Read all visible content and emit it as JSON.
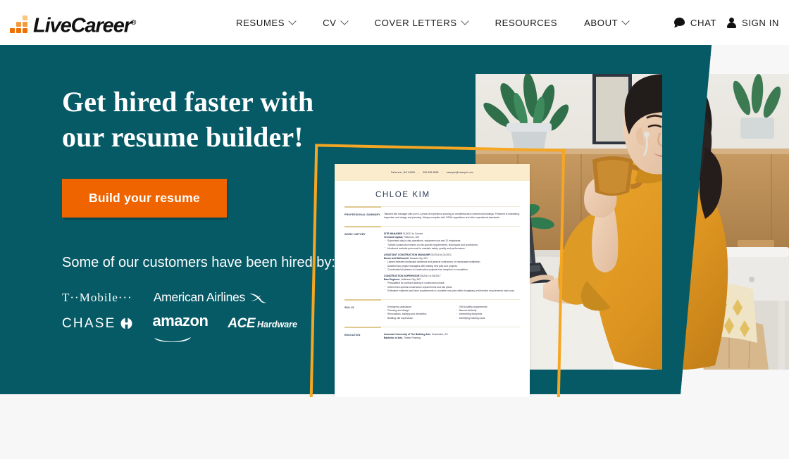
{
  "header": {
    "logo_text": "LiveCareer",
    "logo_reg": "®",
    "nav": [
      {
        "label": "RESUMES",
        "has_chevron": true
      },
      {
        "label": "CV",
        "has_chevron": true
      },
      {
        "label": "COVER LETTERS",
        "has_chevron": true
      },
      {
        "label": "RESOURCES",
        "has_chevron": false
      },
      {
        "label": "ABOUT",
        "has_chevron": true
      }
    ],
    "chat_label": "CHAT",
    "signin_label": "SIGN IN"
  },
  "hero": {
    "headline": "Get hired faster with our resume builder!",
    "cta_label": "Build your resume",
    "subtext": "Some of our customers have been hired by:",
    "brands": [
      "T··Mobile···",
      "American Airlines",
      "CHASE",
      "amazon",
      "ACE Hardware"
    ]
  },
  "resume": {
    "contact": {
      "location": "Patterson, MO 64956",
      "phone": "555-555-5555",
      "email": "example@example.com"
    },
    "name": "CHLOE  KIM",
    "sections": {
      "summary_label": "PROFESSIONAL SUMMARY",
      "summary_text": "Talented site manager with over 11 years of experience working on residential and commercial buildings. Proficient in estimating, inspection and design and planning. Always complies with OSHA regulations and other operational standards.",
      "work_label": "WORK HISTORY",
      "jobs": [
        {
          "title": "SITE MANAGER",
          "dates": "01/2021 to Current",
          "company": "Vreeland Capital",
          "location": "Patterson, MO",
          "bullets": [
            "Supervised day-to-day operations, equipment use and 12 employees.",
            "Trained construction teams on site-specific requirements, techniques and procedures.",
            "Monitored worksite personnel to maintain safety, quality and performance."
          ]
        },
        {
          "title": "ASSISTANT CONSTRUCTION MANAGER",
          "dates": "01/2016 to 01/2021",
          "company": "Burns and McDonnell",
          "location": "Kansas City, MO",
          "bullets": [
            "Liaised between landscape architects and general contractors on hardscape installation.",
            "Assisted two project managers with bidding new jobs and projects.",
            "Coordinated all phases of construction projects from inception to completion."
          ]
        },
        {
          "title": "CONSTRUCTION SUPERVISOR",
          "dates": "05/2012 to 05/2017",
          "company": "Barr Engineer",
          "location": "Jefferson City, MO",
          "bullets": [
            "Prequalified for contract bidding in construction phase.",
            "Determined optimal construction requirements and site plans.",
            "Estimated materials and labor requirements to complete new jobs within budgetary and timeline requirements each year."
          ]
        }
      ],
      "skills_label": "SKILLS",
      "skills_left": [
        "Emergency assistance",
        "Planning and design",
        "Renovations, building and demolition",
        "Building site supervision"
      ],
      "skills_right": [
        "OSHA safety requirements",
        "Manual dexterity",
        "Interpreting blueprints",
        "Identifying building costs"
      ],
      "education_label": "EDUCATION",
      "education_school": "American University of The Building Arts",
      "education_loc": ", Charleston, SC",
      "education_degree": "Bachelor of Arts",
      "education_field": ", Timber Framing"
    }
  },
  "colors": {
    "teal": "#065a66",
    "orange_cta": "#f06400",
    "frame_orange": "#f5a623",
    "logo_orange_dark": "#f07000",
    "logo_orange_light": "#fbc67a",
    "band_cream": "#fbeccd",
    "page_bg": "#f7f7f7"
  }
}
